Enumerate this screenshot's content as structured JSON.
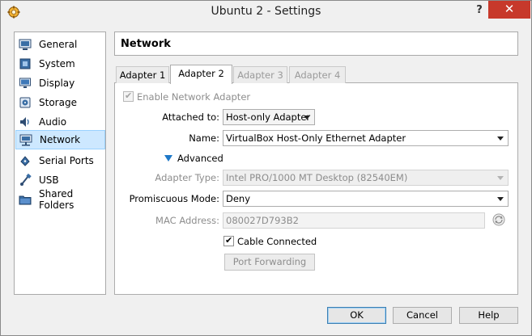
{
  "window": {
    "title": "Ubuntu 2 - Settings",
    "help_glyph": "?",
    "close_glyph": "✕"
  },
  "sidebar": {
    "items": [
      {
        "label": "General",
        "icon": "general-icon"
      },
      {
        "label": "System",
        "icon": "system-icon"
      },
      {
        "label": "Display",
        "icon": "display-icon"
      },
      {
        "label": "Storage",
        "icon": "storage-icon"
      },
      {
        "label": "Audio",
        "icon": "audio-icon"
      },
      {
        "label": "Network",
        "icon": "network-icon",
        "selected": true
      },
      {
        "label": "Serial Ports",
        "icon": "serial-ports-icon"
      },
      {
        "label": "USB",
        "icon": "usb-icon"
      },
      {
        "label": "Shared Folders",
        "icon": "shared-folders-icon"
      }
    ]
  },
  "section": {
    "title": "Network"
  },
  "tabs": [
    {
      "label": "Adapter 1",
      "state": "normal"
    },
    {
      "label": "Adapter 2",
      "state": "active"
    },
    {
      "label": "Adapter 3",
      "state": "disabled"
    },
    {
      "label": "Adapter 4",
      "state": "disabled"
    }
  ],
  "adapter": {
    "enable_label": "Enable Network Adapter",
    "enable_checked": true,
    "attached_label": "Attached to:",
    "attached_value": "Host-only Adapter",
    "name_label": "Name:",
    "name_value": "VirtualBox Host-Only Ethernet Adapter",
    "advanced_label": "Advanced",
    "type_label": "Adapter Type:",
    "type_value": "Intel PRO/1000 MT Desktop (82540EM)",
    "promisc_label": "Promiscuous Mode:",
    "promisc_value": "Deny",
    "mac_label": "MAC Address:",
    "mac_value": "080027D793B2",
    "cable_label": "Cable Connected",
    "cable_checked": true,
    "port_forwarding_label": "Port Forwarding"
  },
  "footer": {
    "ok_label": "OK",
    "cancel_label": "Cancel",
    "help_label": "Help"
  },
  "colors": {
    "selection": "#cde8ff",
    "close_button": "#c7392b",
    "expander": "#1e78c8"
  }
}
